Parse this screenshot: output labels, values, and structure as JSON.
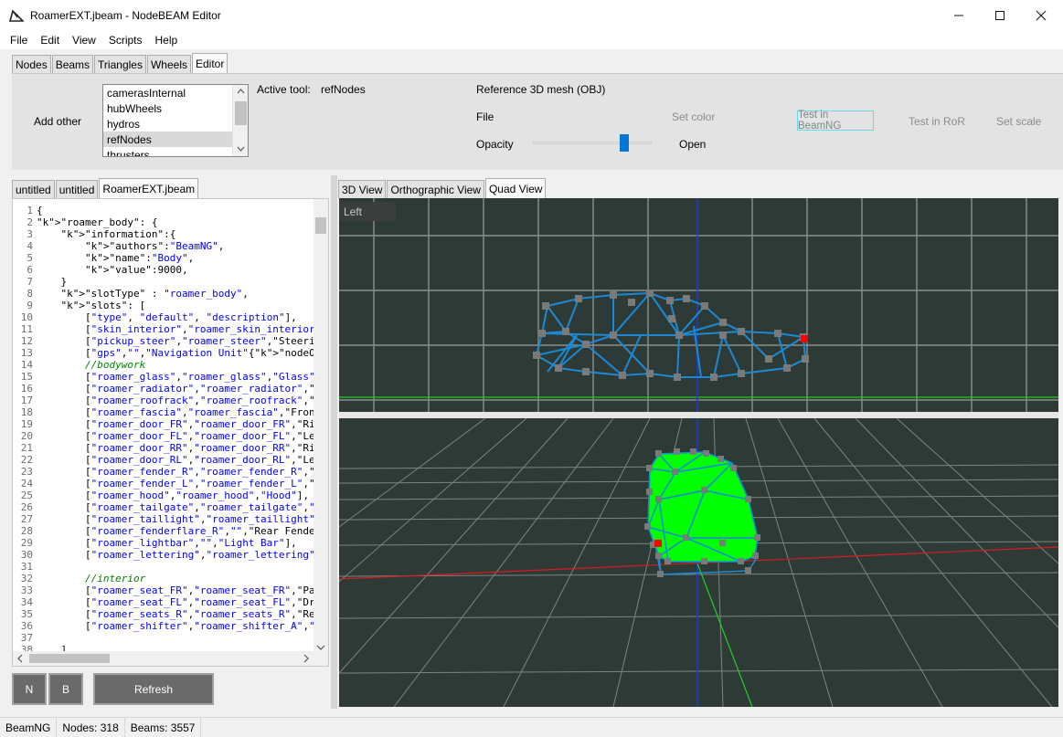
{
  "window": {
    "title": "RoamerEXT.jbeam - NodeBEAM Editor",
    "app_icon": "nodebeam-logo-icon"
  },
  "menu": [
    "File",
    "Edit",
    "View",
    "Scripts",
    "Help"
  ],
  "top_tabs": [
    "Nodes",
    "Beams",
    "Triangles",
    "Wheels",
    "Editor"
  ],
  "top_tabs_active": "Editor",
  "editor_panel": {
    "add_other_label": "Add other",
    "list_items": [
      "camerasInternal",
      "hubWheels",
      "hydros",
      "refNodes",
      "thrusters"
    ],
    "list_selected": "refNodes",
    "active_tool_label": "Active tool:",
    "active_tool_value": "refNodes",
    "ref_mesh_label": "Reference 3D mesh (OBJ)",
    "file_label": "File",
    "set_color_label": "Set color",
    "opacity_label": "Opacity",
    "opacity_level": 0.77,
    "open_label": "Open",
    "test_beamng_label": "Test in BeamNG",
    "test_ror_label": "Test in RoR",
    "set_scale_label": "Set scale"
  },
  "file_tabs": [
    "untitled",
    "untitled",
    "RoamerEXT.jbeam"
  ],
  "file_tabs_active": "RoamerEXT.jbeam",
  "code_lines": [
    "{",
    "\"roamer_body\": {",
    "    \"information\":{",
    "        \"authors\":\"BeamNG\",",
    "        \"name\":\"Body\",",
    "        \"value\":9000,",
    "    }",
    "    \"slotType\" : \"roamer_body\",",
    "    \"slots\": [",
    "        [\"type\", \"default\", \"description\"],",
    "        [\"skin_interior\",\"roamer_skin_interior\", \"Interi",
    "        [\"pickup_steer\",\"roamer_steer\",\"Steering Whe",
    "        [\"gps\",\"\",\"Navigation Unit\"{\"nodeOffset\":{\"x",
    "        //bodywork",
    "        [\"roamer_glass\",\"roamer_glass\",\"Glass\"],",
    "        [\"roamer_radiator\",\"roamer_radiator\",\"Radiato",
    "        [\"roamer_roofrack\",\"roamer_roofrack\",\"Roof R",
    "        [\"roamer_fascia\",\"roamer_fascia\",\"Front Fascia",
    "        [\"roamer_door_FR\",\"roamer_door_FR\",\"Right F",
    "        [\"roamer_door_FL\",\"roamer_door_FL\",\"Left Fro",
    "        [\"roamer_door_RR\",\"roamer_door_RR\",\"Right",
    "        [\"roamer_door_RL\",\"roamer_door_RL\",\"Left Re",
    "        [\"roamer_fender_R\",\"roamer_fender_R\",\"Righ",
    "        [\"roamer_fender_L\",\"roamer_fender_L\",\"Left F",
    "        [\"roamer_hood\",\"roamer_hood\",\"Hood\"],",
    "        [\"roamer_tailgate\",\"roamer_tailgate\",\"Tailgate\"",
    "        [\"roamer_taillight\",\"roamer_taillight\",\"Taillights",
    "        [\"roamer_fenderflare_R\",\"\",\"Rear Fender Flare",
    "        [\"roamer_lightbar\",\"\",\"Light Bar\"],",
    "        [\"roamer_lettering\",\"roamer_lettering\",\"Letteri",
    "",
    "        //interior",
    "        [\"roamer_seat_FR\",\"roamer_seat_FR\",\"Passen",
    "        [\"roamer_seat_FL\",\"roamer_seat_FL\",\"Driver S",
    "        [\"roamer_seats_R\",\"roamer_seats_R\",\"Rear Be",
    "        [\"roamer_shifter\",\"roamer_shifter_A\",\"Shifter\"",
    "",
    "    ],"
  ],
  "buttons": {
    "n": "N",
    "b": "B",
    "refresh": "Refresh"
  },
  "view_tabs": [
    "3D View",
    "Orthographic View",
    "Quad View"
  ],
  "view_tabs_active": "Quad View",
  "viewport": {
    "top_label": "Left"
  },
  "colors": {
    "viewport_bg": "#2e3a36",
    "grid": "#8a8f8c",
    "mesh_wire": "#1b8ad6",
    "mesh_fill": "#00ff00",
    "node": "#7a7a7a",
    "selected_node": "#ff0000",
    "axis_x": "#d81c1c",
    "axis_y": "#1f3bd6",
    "axis_z": "#22d122"
  },
  "status": {
    "app": "BeamNG",
    "nodes": "Nodes: 318",
    "beams": "Beams: 3557"
  }
}
